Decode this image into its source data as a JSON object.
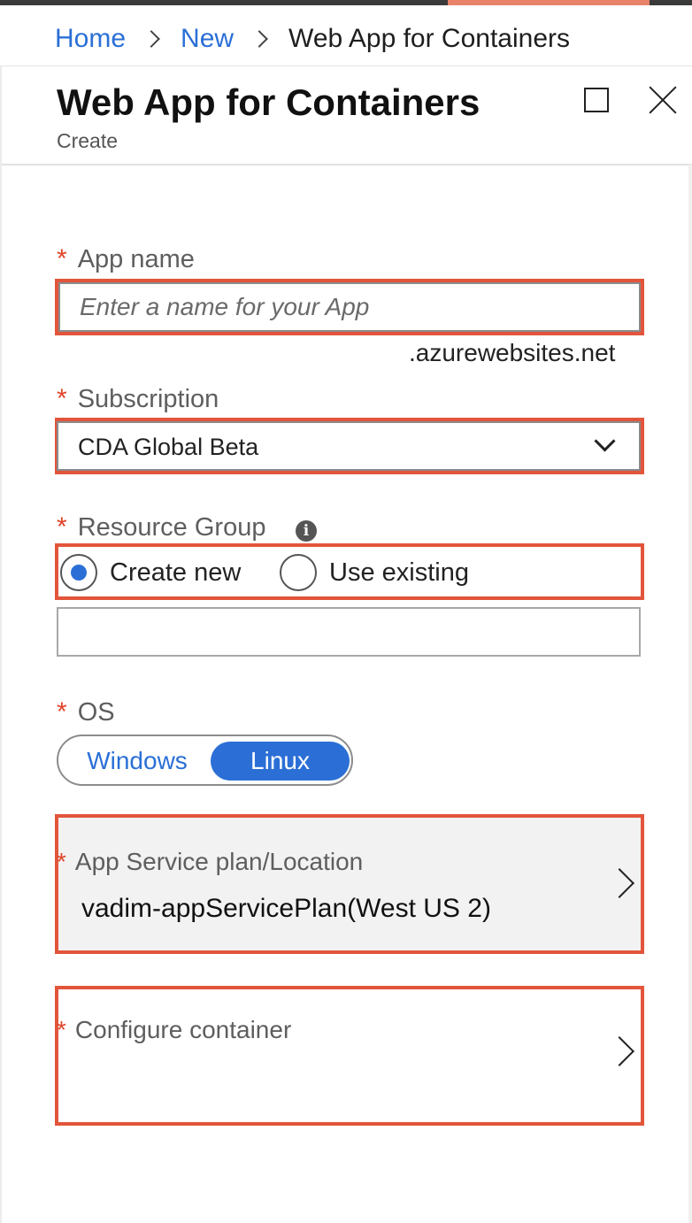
{
  "breadcrumb": {
    "items": [
      "Home",
      "New"
    ],
    "current": "Web App for Containers"
  },
  "header": {
    "title": "Web App for Containers",
    "subtitle": "Create",
    "maximize_icon": "maximize-icon",
    "close_icon": "close-icon"
  },
  "form": {
    "app_name": {
      "required_mark": "*",
      "label": "App name",
      "value": "",
      "placeholder": "Enter a name for your App",
      "suffix": ".azurewebsites.net"
    },
    "subscription": {
      "required_mark": "*",
      "label": "Subscription",
      "selected": "CDA Global Beta",
      "icon": "chevron-down-icon"
    },
    "resource_group": {
      "required_mark": "*",
      "label": "Resource Group",
      "info_glyph": "i",
      "options": [
        "Create new",
        "Use existing"
      ],
      "selected": "Create new",
      "name_value": ""
    },
    "os": {
      "required_mark": "*",
      "label": "OS",
      "options": [
        "Windows",
        "Linux"
      ],
      "selected": "Linux"
    },
    "app_service_plan": {
      "required_mark": "*",
      "label": "App Service plan/Location",
      "value": "vadim-appServicePlan(West US 2)"
    },
    "configure_container": {
      "required_mark": "*",
      "label": "Configure container"
    }
  },
  "colors": {
    "accent_blue": "#2b6fd6",
    "link_blue": "#2a6fd6",
    "highlight_red": "#e2553b",
    "required_red": "#e0452b",
    "top_accent": "#e8836a"
  }
}
